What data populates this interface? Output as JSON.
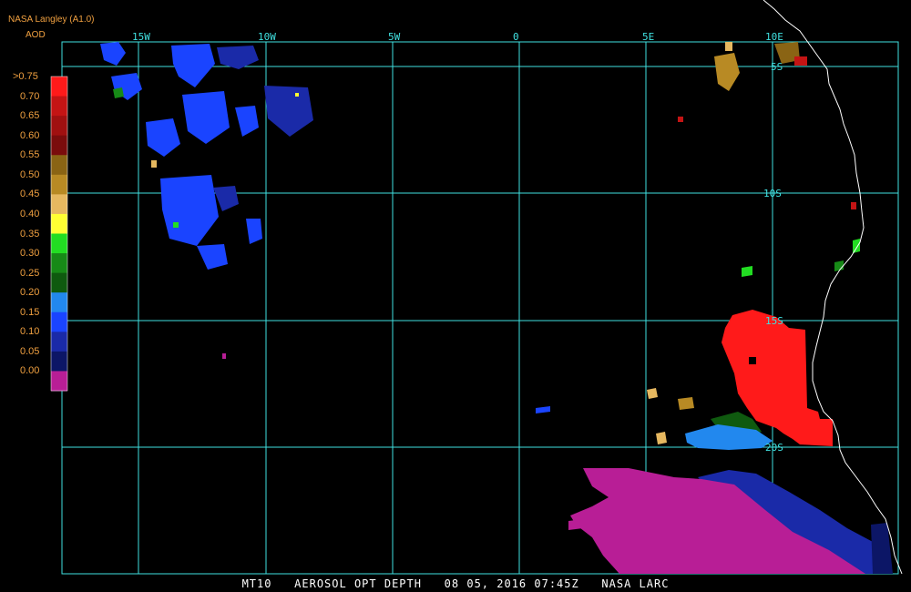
{
  "header": {
    "producer": "NASA Langley (A1.0)",
    "parameter": "AOD"
  },
  "legend": {
    "entries": [
      {
        "label": ">0.75",
        "color": "#ff1a1a"
      },
      {
        "label": "0.70",
        "color": "#c41414"
      },
      {
        "label": "0.65",
        "color": "#a01010"
      },
      {
        "label": "0.60",
        "color": "#7a0c0c"
      },
      {
        "label": "0.55",
        "color": "#8a6414"
      },
      {
        "label": "0.50",
        "color": "#b88a24"
      },
      {
        "label": "0.45",
        "color": "#e6b860"
      },
      {
        "label": "0.40",
        "color": "#ffff33"
      },
      {
        "label": "0.35",
        "color": "#22dd22"
      },
      {
        "label": "0.30",
        "color": "#178a17"
      },
      {
        "label": "0.25",
        "color": "#0f5a0f"
      },
      {
        "label": "0.20",
        "color": "#2288ee"
      },
      {
        "label": "0.15",
        "color": "#1a44ff"
      },
      {
        "label": "0.10",
        "color": "#1a2aa8"
      },
      {
        "label": "0.05",
        "color": "#0c1666"
      },
      {
        "label": "0.00",
        "color": "#b81e96"
      }
    ]
  },
  "grid": {
    "longitudes": [
      "15W",
      "10W",
      "5W",
      "0",
      "5E",
      "10E"
    ],
    "latitudes": [
      "5S",
      "10S",
      "15S",
      "20S"
    ]
  },
  "footer": {
    "product": "MT10",
    "title": "AEROSOL OPT DEPTH",
    "datetime": "08 05, 2016 07:45Z",
    "credit": "NASA LARC"
  },
  "colors": {
    "grid": "#40e0e0",
    "coast": "#ffffff",
    "text_orange": "#f0a040"
  }
}
